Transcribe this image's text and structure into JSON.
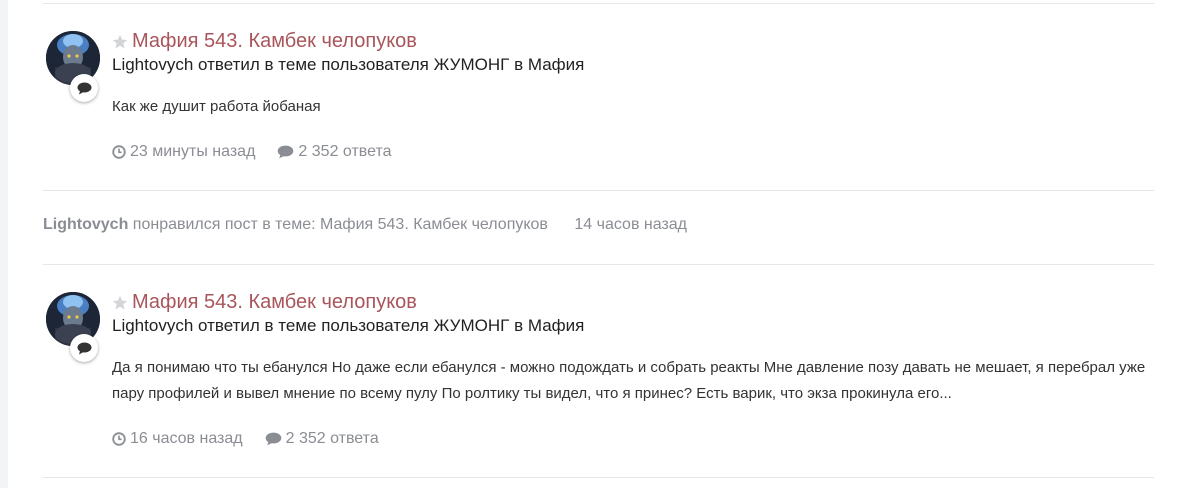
{
  "entries": [
    {
      "title": "Мафия 543. Камбек челопуков",
      "author": "Lightovych",
      "action_text": "ответил в теме пользователя",
      "topic_starter": "ЖУМОНГ",
      "in_text": "в",
      "forum": "Мафия",
      "snippet": "Как же душит работа йобаная",
      "time": "23 минуты назад",
      "replies": "2 352 ответа"
    },
    {
      "title": "Мафия 543. Камбек челопуков",
      "author": "Lightovych",
      "action_text": "ответил в теме пользователя",
      "topic_starter": "ЖУМОНГ",
      "in_text": "в",
      "forum": "Мафия",
      "snippet": "Да я понимаю что ты ебанулся Но даже если ебанулся - можно подождать и собрать реакты Мне давление позу давать не мешает, я перебрал уже пару профилей и вывел мнение по всему пулу По ролтику ты видел, что я принес? Есть варик, что экза прокинула его...",
      "time": "16 часов назад",
      "replies": "2 352 ответа"
    }
  ],
  "like_activity": {
    "user": "Lightovych",
    "action": "понравился пост в теме:",
    "topic": "Мафия 543. Камбек челопуков",
    "time": "14 часов назад"
  },
  "colors": {
    "title": "#a8555b",
    "meta": "#8a8d93",
    "text": "#222222",
    "divider": "#e6e7ea"
  },
  "icons": [
    "star-icon",
    "comment-icon",
    "clock-icon",
    "comments-icon"
  ]
}
